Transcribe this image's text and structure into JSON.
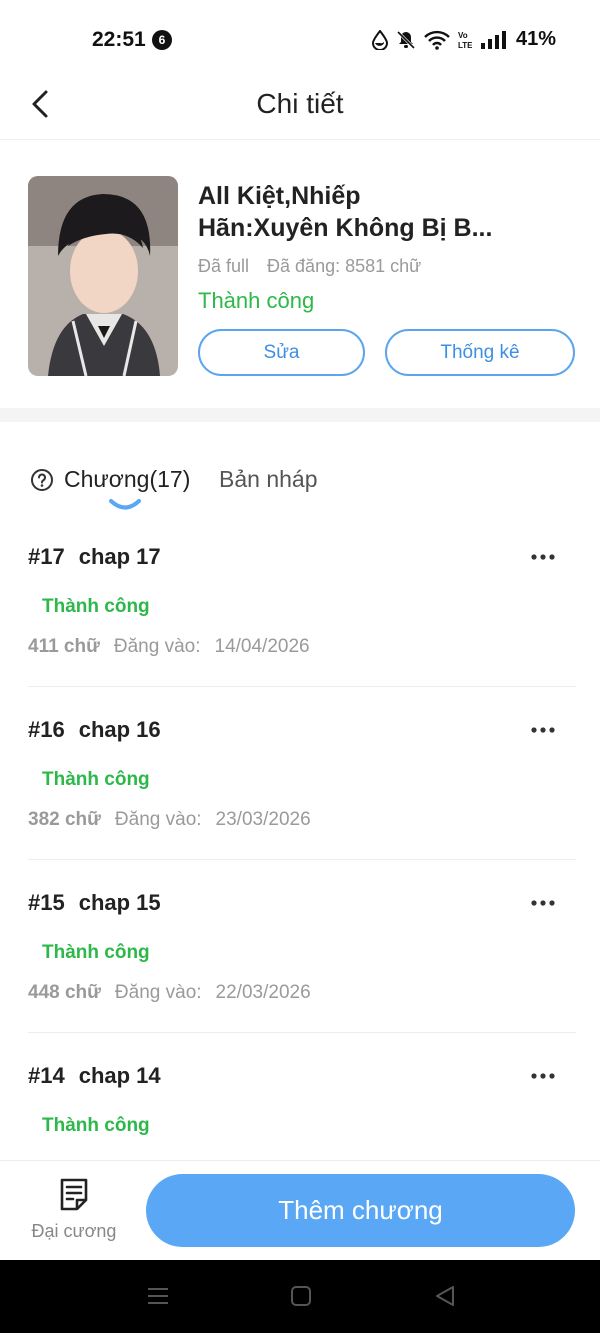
{
  "status": {
    "time": "22:51",
    "notification_count": "6",
    "battery": "41%",
    "icons": [
      "drop-icon",
      "mute-bell-icon",
      "wifi-icon",
      "volte-icon",
      "signal-icon"
    ]
  },
  "header": {
    "title": "Chi tiết",
    "back_icon": "chevron-left-icon"
  },
  "book": {
    "title": "All Kiệt,Nhiếp Hãn:Xuyên Không Bị B...",
    "completion": "Đã full",
    "posted": "Đã đăng: 8581 chữ",
    "status": "Thành công",
    "edit_label": "Sửa",
    "stats_label": "Thống kê"
  },
  "tabs": {
    "chapters_label": "Chương(17)",
    "drafts_label": "Bản nháp",
    "help_icon": "question-circle-icon"
  },
  "chapters": [
    {
      "num": "#17",
      "name": "chap 17",
      "status": "Thành công",
      "words": "411 chữ",
      "posted_label": "Đăng vào:",
      "date": "14/04/2026"
    },
    {
      "num": "#16",
      "name": "chap 16",
      "status": "Thành công",
      "words": "382 chữ",
      "posted_label": "Đăng vào:",
      "date": "23/03/2026"
    },
    {
      "num": "#15",
      "name": "chap 15",
      "status": "Thành công",
      "words": "448 chữ",
      "posted_label": "Đăng vào:",
      "date": "22/03/2026"
    },
    {
      "num": "#14",
      "name": "chap 14",
      "status": "Thành công",
      "words": "",
      "posted_label": "",
      "date": ""
    }
  ],
  "bottom": {
    "outline_label": "Đại cương",
    "add_chapter_label": "Thêm chương"
  },
  "colors": {
    "accent": "#5aa8f5",
    "success": "#2db84a",
    "muted": "#9a9a9a"
  }
}
